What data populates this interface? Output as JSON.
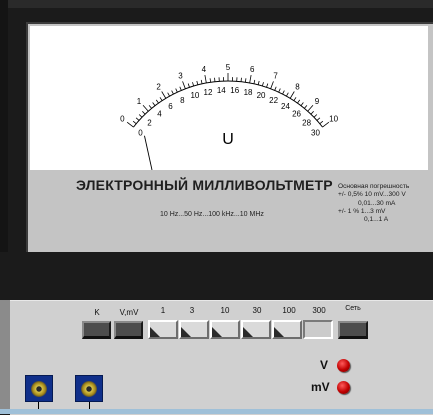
{
  "meter": {
    "outer_scale_labels": [
      "0",
      "1",
      "2",
      "3",
      "4",
      "5",
      "6",
      "7",
      "8",
      "9",
      "10"
    ],
    "inner_scale_labels": [
      "0",
      "2",
      "4",
      "6",
      "8",
      "10",
      "12",
      "14",
      "16",
      "18",
      "20",
      "22",
      "24",
      "26",
      "28",
      "30"
    ],
    "unit_symbol": "U",
    "title": "ЭЛЕКТРОННЫЙ МИЛЛИВОЛЬТМЕТР",
    "frequency_range": "10 Hz...50 Hz...100 kHz...10 MHz",
    "accuracy": {
      "heading": "Основная погрешность",
      "line1": "+/- 0,5% 10 mV...300 V",
      "line2": "0,01...30 mA",
      "line3": "+/- 1 %   1...3 mV",
      "line4": "0,1...1 A"
    },
    "needle_value": 0
  },
  "controls": {
    "k_label": "K",
    "vmv_label": "V,mV",
    "ranges": [
      "1",
      "3",
      "10",
      "30",
      "100",
      "300"
    ],
    "active_range_index": 5,
    "power_label": "Сеть"
  },
  "indicators": {
    "v_label": "V",
    "mv_label": "mV"
  },
  "colors": {
    "panel": "#c4c4c4",
    "scale_bg": "#ffffff",
    "led": "#c00000",
    "jack": "#0f2f8a"
  }
}
